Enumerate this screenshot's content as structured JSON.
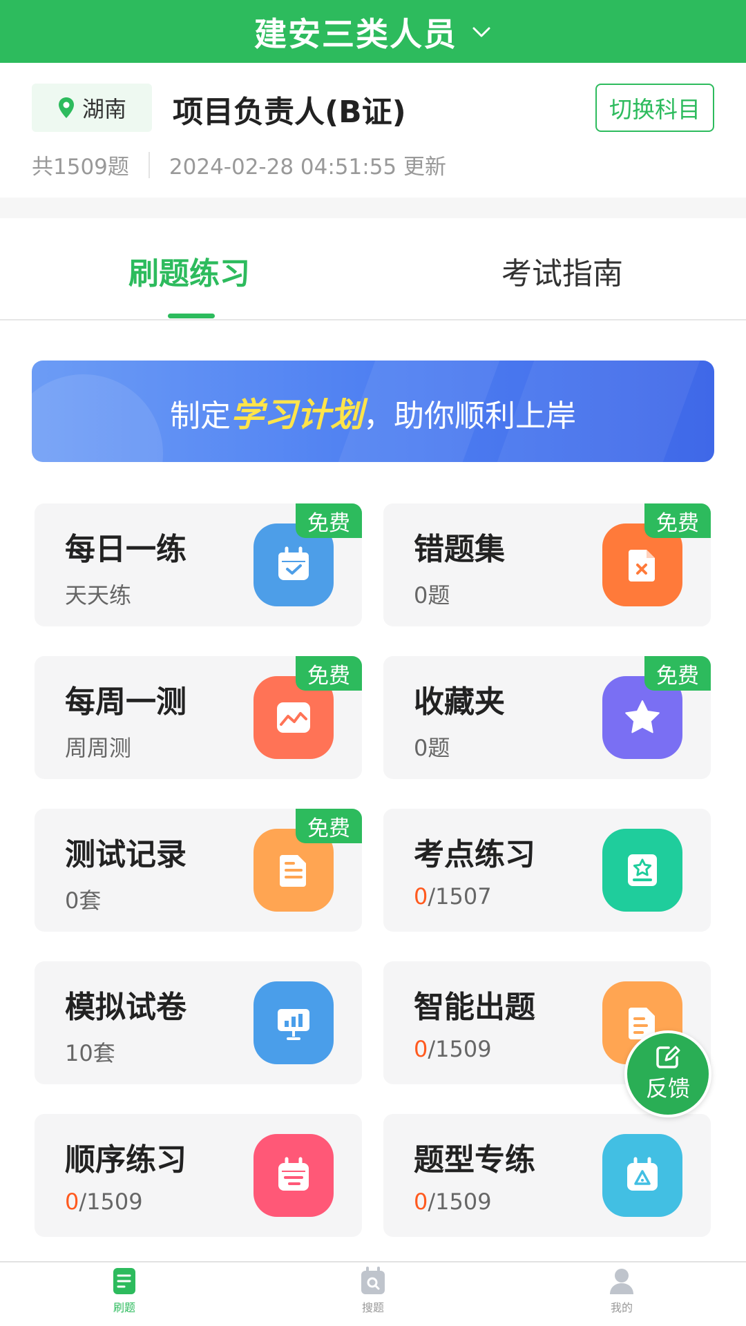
{
  "header": {
    "title": "建安三类人员"
  },
  "info": {
    "region": "湖南",
    "subject": "项目负责人(B证)",
    "switch_label": "切换科目",
    "question_count": "共1509题",
    "updated": "2024-02-28 04:51:55 更新"
  },
  "tabs": {
    "practice": "刷题练习",
    "guide": "考试指南"
  },
  "banner": {
    "prefix": "制定",
    "highlight": "学习计划",
    "suffix": "，助你顺利上岸"
  },
  "cards": [
    {
      "title": "每日一练",
      "sub_text": "天天练",
      "badge": "免费",
      "icon": "calendar-check-icon",
      "color": "#4d9ee8"
    },
    {
      "title": "错题集",
      "sub_text": "0题",
      "badge": "免费",
      "icon": "wrong-doc-icon",
      "color": "#ff7a3a"
    },
    {
      "title": "每周一测",
      "sub_text": "周周测",
      "badge": "免费",
      "icon": "trend-chart-icon",
      "color": "#ff7356"
    },
    {
      "title": "收藏夹",
      "sub_text": "0题",
      "badge": "免费",
      "icon": "star-icon",
      "color": "#7a6ff3"
    },
    {
      "title": "测试记录",
      "sub_text": "0套",
      "badge": "免费",
      "icon": "document-icon",
      "color": "#ffa552"
    },
    {
      "title": "考点练习",
      "done": "0",
      "total": "/1507",
      "icon": "star-card-icon",
      "color": "#1fcd9c"
    },
    {
      "title": "模拟试卷",
      "sub_text": "10套",
      "icon": "presentation-board-icon",
      "color": "#4a9eea"
    },
    {
      "title": "智能出题",
      "done": "0",
      "total": "/1509",
      "icon": "smart-doc-icon",
      "color": "#ffa552"
    },
    {
      "title": "顺序练习",
      "done": "0",
      "total": "/1509",
      "icon": "list-calendar-icon",
      "color": "#ff5877"
    },
    {
      "title": "题型专练",
      "done": "0",
      "total": "/1509",
      "icon": "triangle-calendar-icon",
      "color": "#42bfe3"
    }
  ],
  "feedback": {
    "label": "反馈"
  },
  "tabbar": {
    "items": [
      {
        "label": "刷题",
        "icon": "practice-doc-icon"
      },
      {
        "label": "搜题",
        "icon": "search-calendar-icon"
      },
      {
        "label": "我的",
        "icon": "user-icon"
      }
    ]
  }
}
